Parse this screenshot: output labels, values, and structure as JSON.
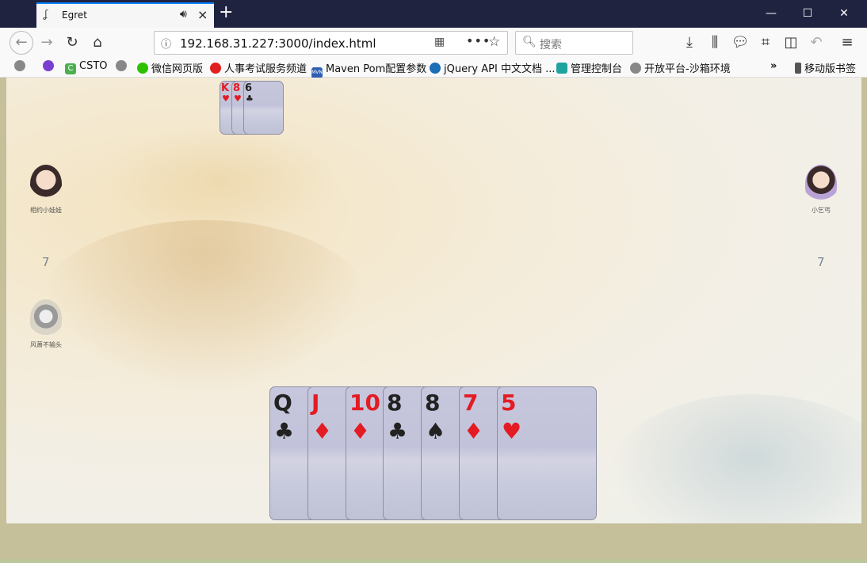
{
  "browser": {
    "tab_title": "Egret",
    "url": "192.168.31.227:3000/index.html",
    "search_placeholder": "搜索",
    "newtab_label": "+",
    "window_controls": {
      "minimize": "—",
      "maximize": "☐",
      "close": "✕"
    }
  },
  "bookmarks": [
    {
      "label": "",
      "icon": "globe-icon"
    },
    {
      "label": "",
      "icon": "purple-orb-icon"
    },
    {
      "label": "CSTO",
      "icon": "csto-icon"
    },
    {
      "label": "",
      "icon": "globe-icon"
    },
    {
      "label": "微信网页版",
      "icon": "wechat-icon"
    },
    {
      "label": "人事考试服务频道",
      "icon": "hr-exam-icon"
    },
    {
      "label": "Maven Pom配置参数",
      "icon": "maven-icon"
    },
    {
      "label": "jQuery API 中文文档 ...",
      "icon": "jquery-icon"
    },
    {
      "label": "管理控制台",
      "icon": "console-icon"
    },
    {
      "label": "开放平台-沙箱环境",
      "icon": "globe-icon"
    },
    {
      "label": "移动版书签",
      "icon": "mobile-icon"
    }
  ],
  "game": {
    "players": {
      "left": {
        "name": "相约小娃娃",
        "card_count": "7"
      },
      "right": {
        "name": "小乞丐",
        "card_count": "7"
      },
      "left_bottom": {
        "name": "风萧不输头"
      }
    },
    "played_cards": [
      {
        "rank": "K",
        "suit": "♥",
        "color": "red"
      },
      {
        "rank": "8",
        "suit": "♥",
        "color": "red"
      },
      {
        "rank": "6",
        "suit": "♣",
        "color": "black"
      }
    ],
    "hand": [
      {
        "rank": "Q",
        "suit": "♣",
        "color": "black"
      },
      {
        "rank": "J",
        "suit": "♦",
        "color": "red"
      },
      {
        "rank": "10",
        "suit": "♦",
        "color": "red"
      },
      {
        "rank": "8",
        "suit": "♣",
        "color": "black"
      },
      {
        "rank": "8",
        "suit": "♠",
        "color": "black"
      },
      {
        "rank": "7",
        "suit": "♦",
        "color": "red"
      },
      {
        "rank": "5",
        "suit": "♥",
        "color": "red"
      }
    ]
  },
  "colors": {
    "red_suit": "#e41b23",
    "black_suit": "#222222",
    "card_back": "#c4c6dc",
    "bottom_bar": "#c5bf9a"
  }
}
